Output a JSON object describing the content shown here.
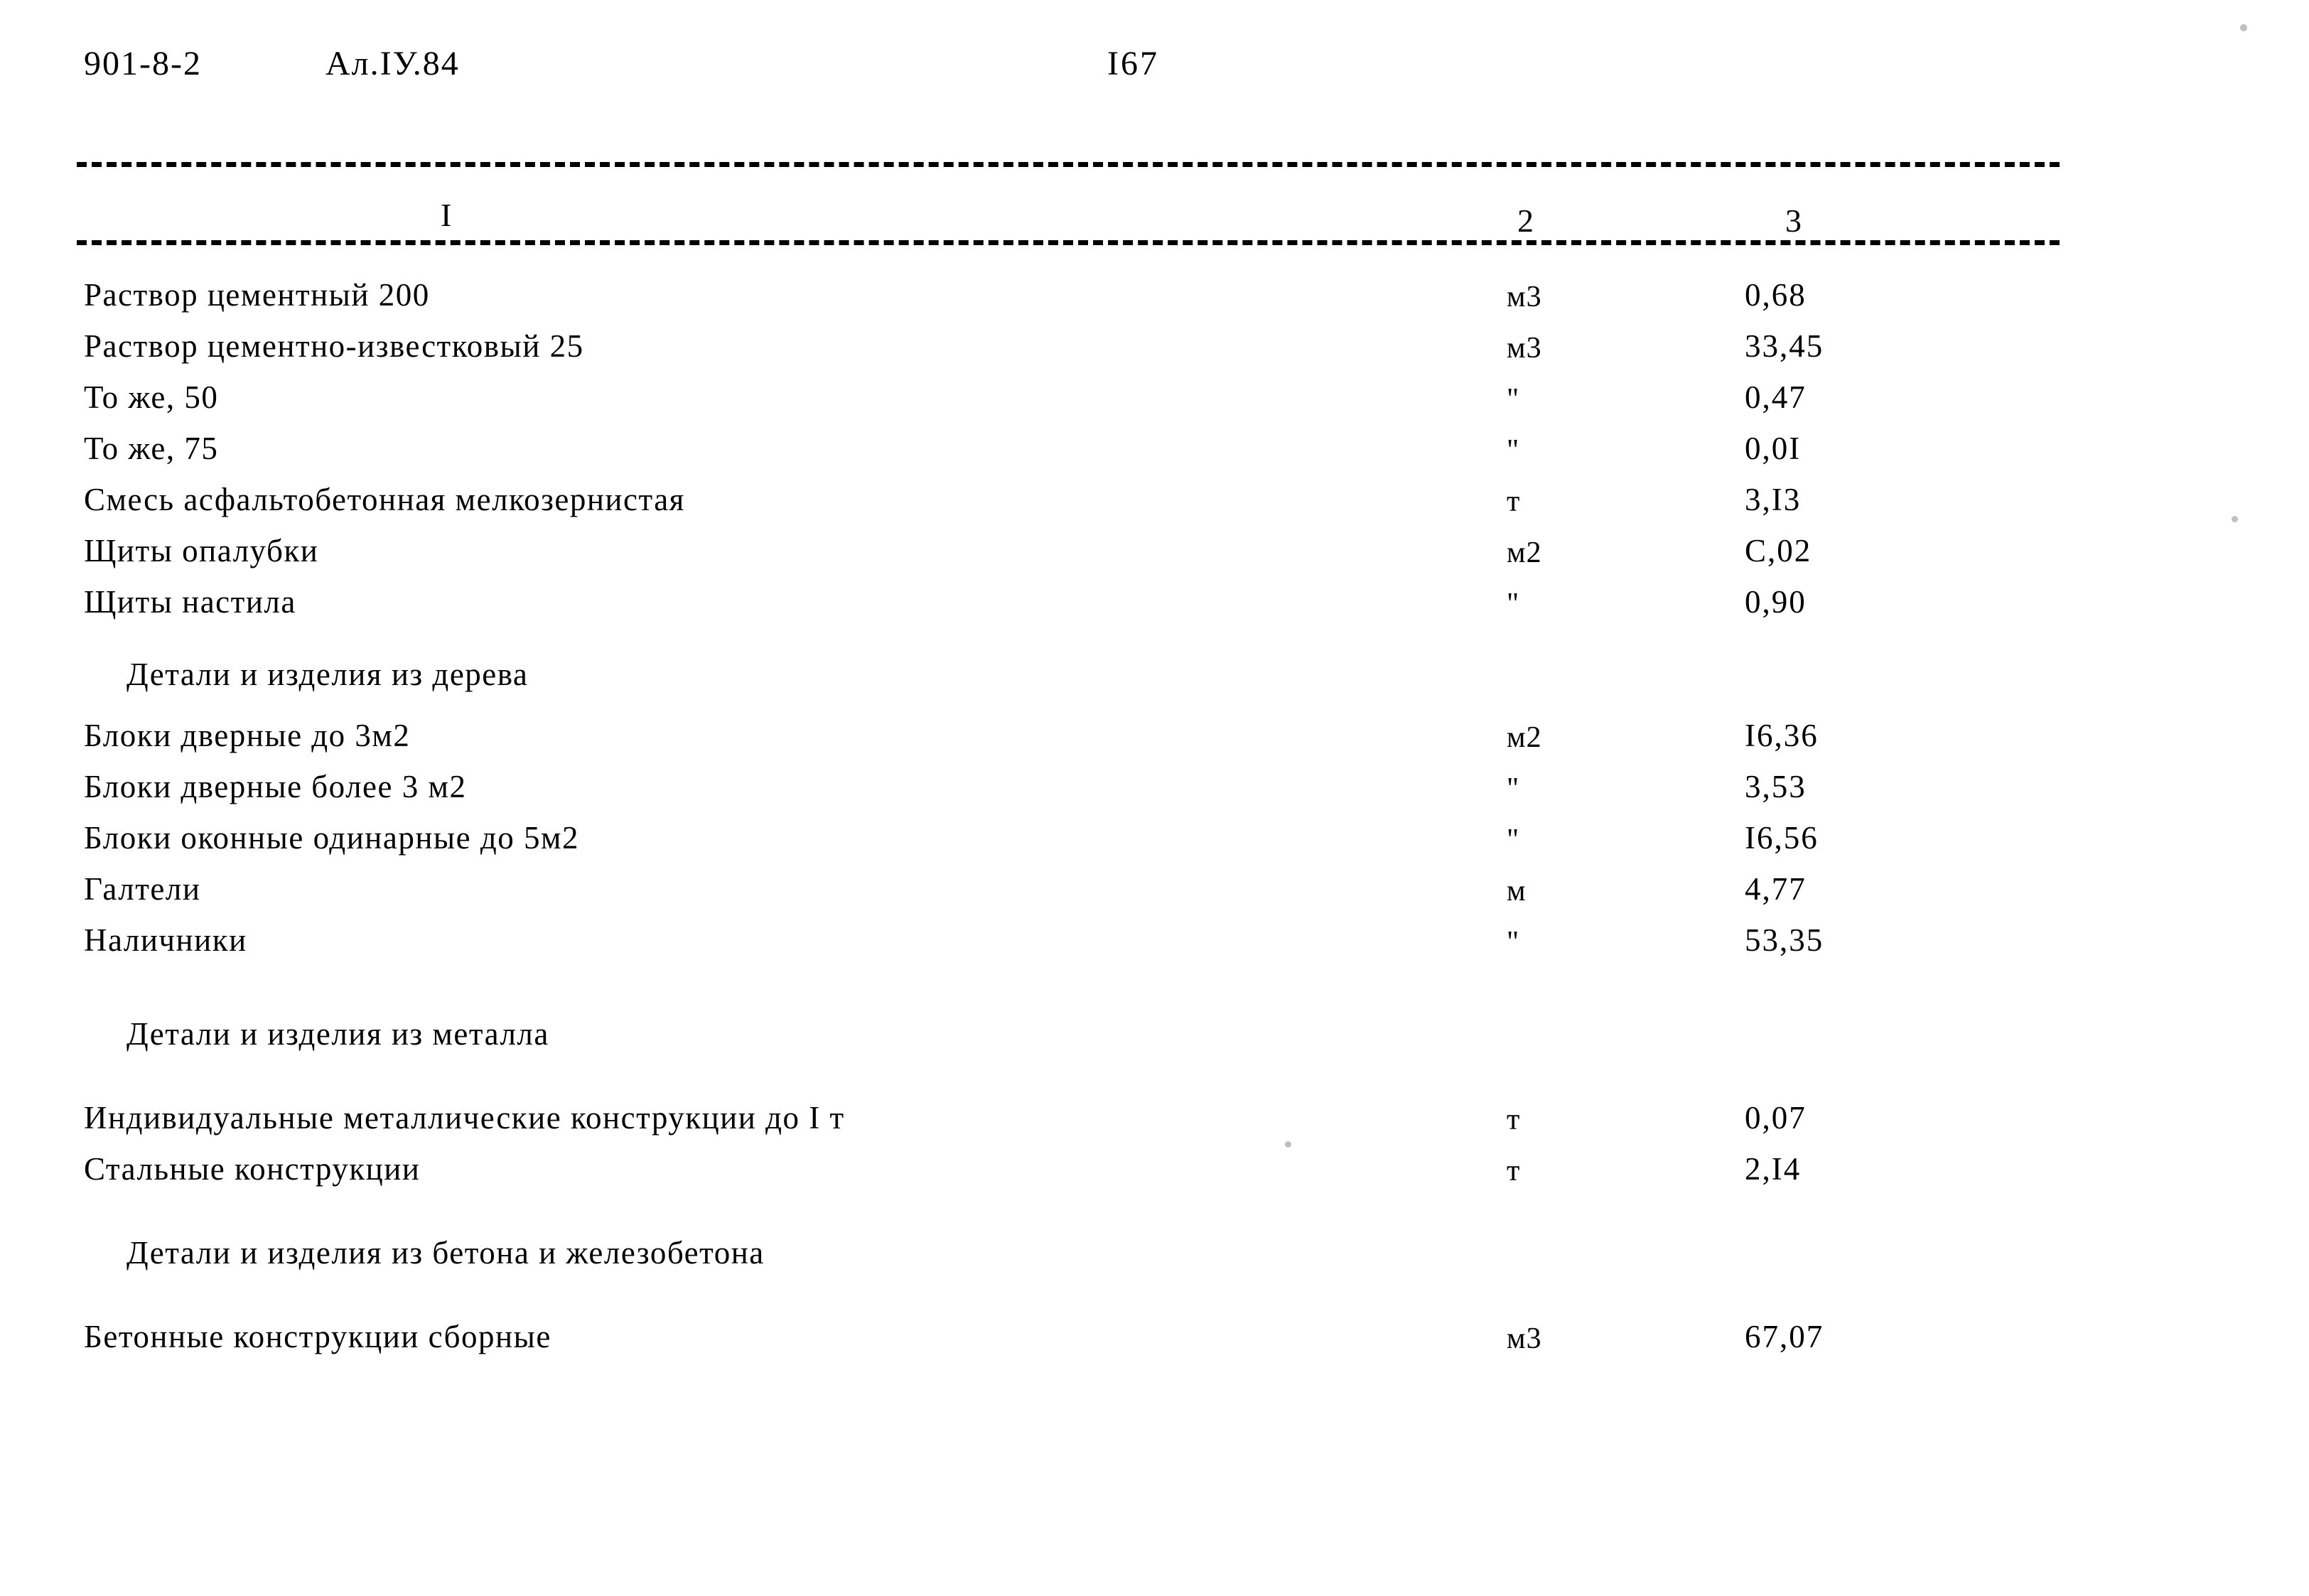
{
  "header": {
    "doc_code": "901-8-2",
    "album": "Ал.IУ.84",
    "page_number": "I67"
  },
  "table": {
    "column_headers": {
      "col1": "I",
      "col2": "2",
      "col3": "3"
    },
    "rows": [
      {
        "type": "item",
        "desc": "Раствор цементный 200",
        "unit": "м3",
        "qty": "0,68"
      },
      {
        "type": "item",
        "desc": "Раствор цементно-известковый 25",
        "unit": "м3",
        "qty": "33,45"
      },
      {
        "type": "item",
        "desc": "То же,  50",
        "unit": "\"",
        "qty": "0,47"
      },
      {
        "type": "item",
        "desc": "То же, 75",
        "unit": "\"",
        "qty": "0,0I"
      },
      {
        "type": "item",
        "desc": "Смесь асфальтобетонная мелкозернистая",
        "unit": "т",
        "qty": "3,I3"
      },
      {
        "type": "item",
        "desc": "Щиты опалубки",
        "unit": "м2",
        "qty": "С,02"
      },
      {
        "type": "item",
        "desc": "Щиты настила",
        "unit": "\"",
        "qty": "0,90"
      },
      {
        "type": "section",
        "desc": "Детали и изделия из дерева",
        "unit": "",
        "qty": ""
      },
      {
        "type": "item",
        "desc": "Блоки дверные до 3м2",
        "unit": "м2",
        "qty": "I6,36"
      },
      {
        "type": "item",
        "desc": "Блоки дверные более 3 м2",
        "unit": "\"",
        "qty": "3,53"
      },
      {
        "type": "item",
        "desc": "Блоки оконные одинарные до 5м2",
        "unit": "\"",
        "qty": "I6,56"
      },
      {
        "type": "item",
        "desc": "Галтели",
        "unit": "м",
        "qty": "4,77"
      },
      {
        "type": "item",
        "desc": "Наличники",
        "unit": "\"",
        "qty": "53,35"
      },
      {
        "type": "section",
        "desc": "Детали и изделия  из металла",
        "unit": "",
        "qty": ""
      },
      {
        "type": "item",
        "desc": "Индивидуальные металлические конструкции до I т",
        "unit": "т",
        "qty": "0,07"
      },
      {
        "type": "item",
        "desc": "Стальные конструкции",
        "unit": "т",
        "qty": "2,I4"
      },
      {
        "type": "section",
        "desc": "Детали и изделия из бетона и железобетона",
        "unit": "",
        "qty": ""
      },
      {
        "type": "item",
        "desc": "Бетонные конструкции сборные",
        "unit": "м3",
        "qty": "67,07"
      }
    ]
  }
}
